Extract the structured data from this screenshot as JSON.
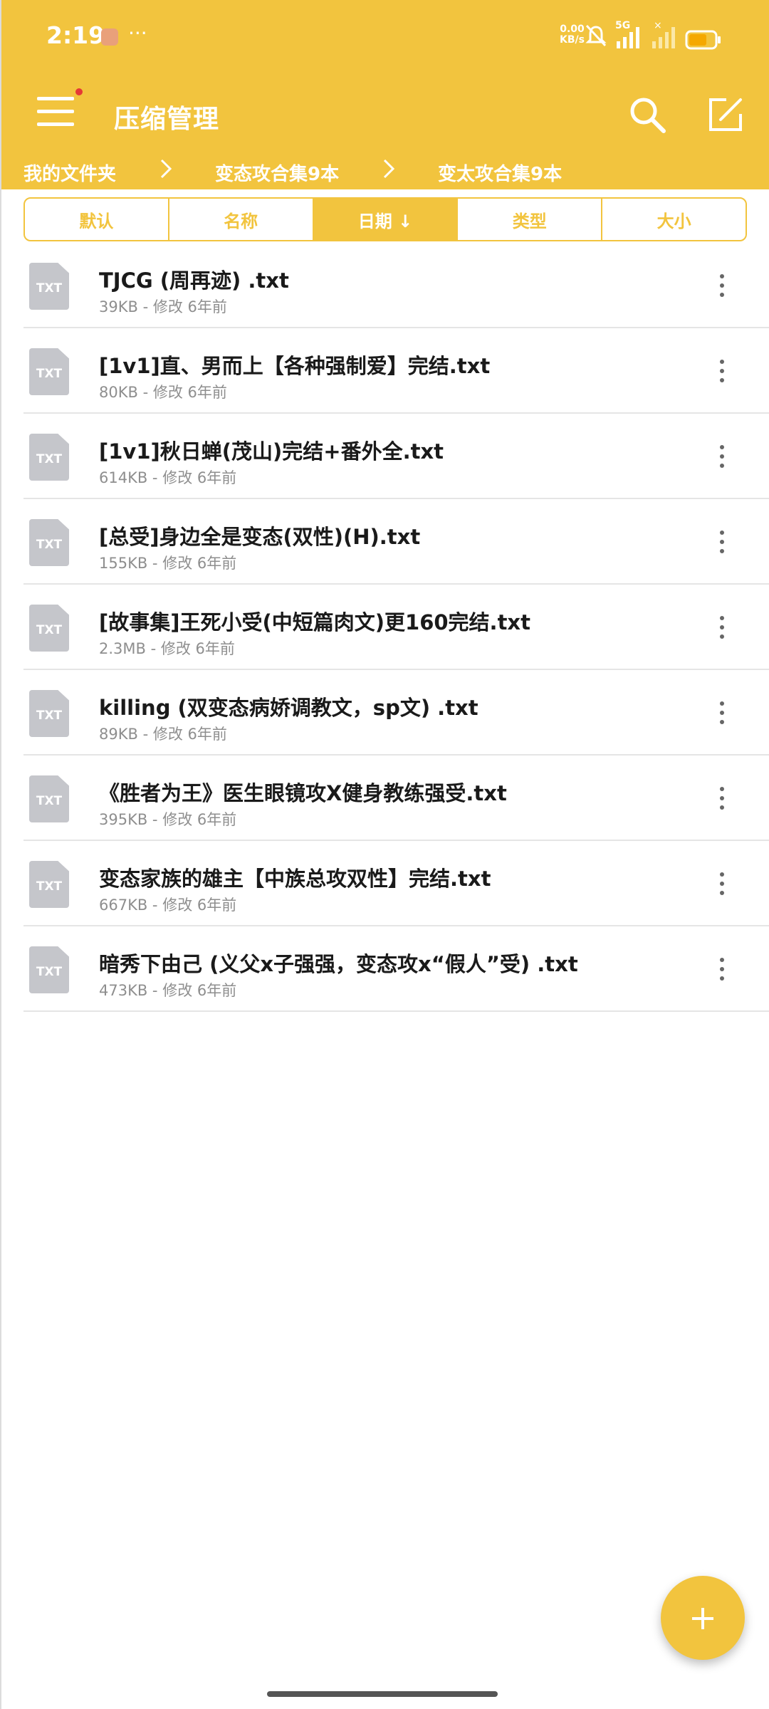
{
  "status_bar": {
    "time": "2:19",
    "dots": "···",
    "net_speed_value": "0.00",
    "net_speed_unit": "KB/s",
    "network": "5G"
  },
  "header": {
    "title": "压缩管理"
  },
  "breadcrumb": [
    "我的文件夹",
    "变态攻合集9本",
    "变太攻合集9本"
  ],
  "sort_tabs": [
    {
      "label": "默认",
      "active": false
    },
    {
      "label": "名称",
      "active": false
    },
    {
      "label": "日期 ↓",
      "active": true
    },
    {
      "label": "类型",
      "active": false
    },
    {
      "label": "大小",
      "active": false
    }
  ],
  "file_icon_label": "TXT",
  "files": [
    {
      "name": "TJCG (周再迹) .txt",
      "meta": "39KB - 修改 6年前"
    },
    {
      "name": "[1v1]直、男而上【各种强制爱】完结.txt",
      "meta": "80KB - 修改 6年前"
    },
    {
      "name": "[1v1]秋日蝉(茂山)完结+番外全.txt",
      "meta": "614KB - 修改 6年前"
    },
    {
      "name": "[总受]身边全是变态(双性)(H).txt",
      "meta": "155KB - 修改 6年前"
    },
    {
      "name": "[故事集]王死小受(中短篇肉文)更160完结.txt",
      "meta": "2.3MB - 修改 6年前"
    },
    {
      "name": "killing (双变态病娇调教文，sp文) .txt",
      "meta": "89KB - 修改 6年前"
    },
    {
      "name": "《胜者为王》医生眼镜攻X健身教练强受.txt",
      "meta": "395KB - 修改 6年前"
    },
    {
      "name": "变态家族的雄主【中族总攻双性】完结.txt",
      "meta": "667KB - 修改 6年前"
    },
    {
      "name": "暗秀下由己 (义父x子强强，变态攻x“假人”受) .txt",
      "meta": "473KB - 修改 6年前"
    }
  ]
}
